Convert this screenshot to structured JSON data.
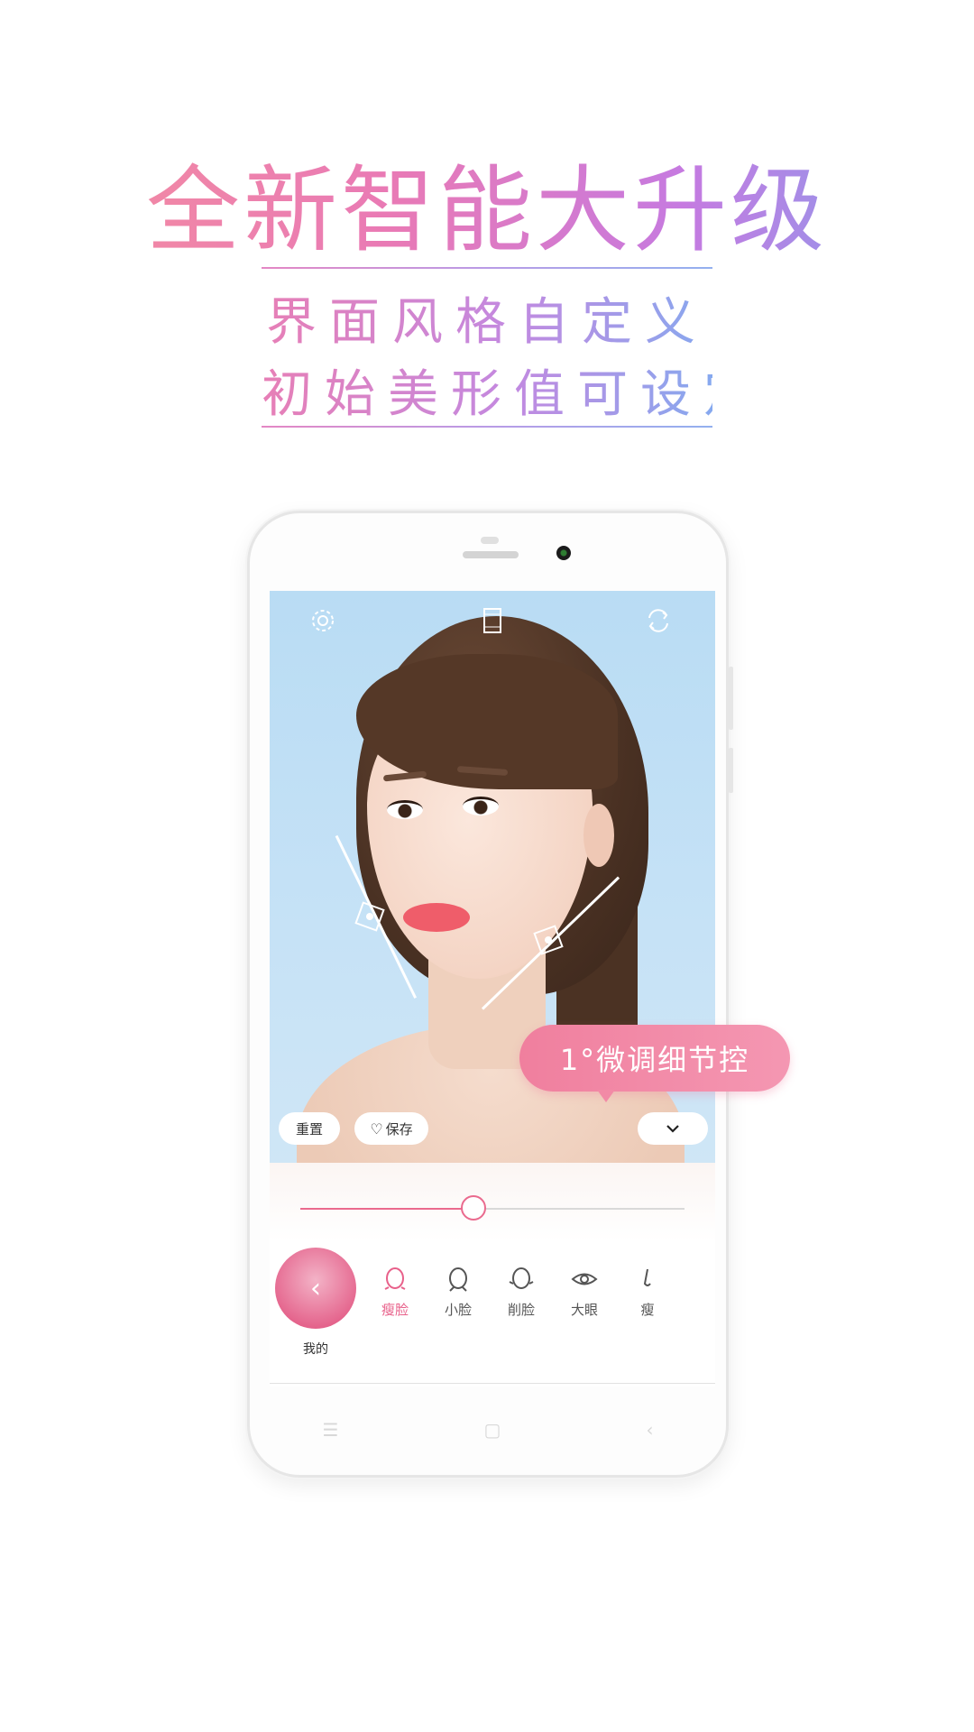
{
  "headline": "全新智能大升级",
  "subtitle": {
    "line1": "界面风格自定义",
    "line2": "初始美形值可设定"
  },
  "colors": {
    "accent": "#e8608a",
    "tooltip": "#f07f9e",
    "photo_bg": "#c6e2f6"
  },
  "camera_toolbar": {
    "settings_icon": "gear-icon",
    "ratio_icon": "aspect-ratio-icon",
    "switch_icon": "camera-switch-icon"
  },
  "actions": {
    "reset_label": "重置",
    "save_label": "保存",
    "collapse_icon": "chevron-down-icon"
  },
  "tooltip": {
    "text": "1°微调细节控"
  },
  "slider": {
    "value_fraction": 0.45
  },
  "presets": {
    "my_label": "我的",
    "items": [
      {
        "label": "瘦脸",
        "icon": "face-slim-icon",
        "active": true
      },
      {
        "label": "小脸",
        "icon": "face-small-icon",
        "active": false
      },
      {
        "label": "削脸",
        "icon": "face-shave-icon",
        "active": false
      },
      {
        "label": "大眼",
        "icon": "eye-enlarge-icon",
        "active": false
      },
      {
        "label": "瘦",
        "icon": "nose-slim-icon",
        "active": false
      }
    ]
  },
  "nav": {
    "menu_icon": "menu-icon",
    "home_icon": "home-icon",
    "back_icon": "back-icon"
  }
}
